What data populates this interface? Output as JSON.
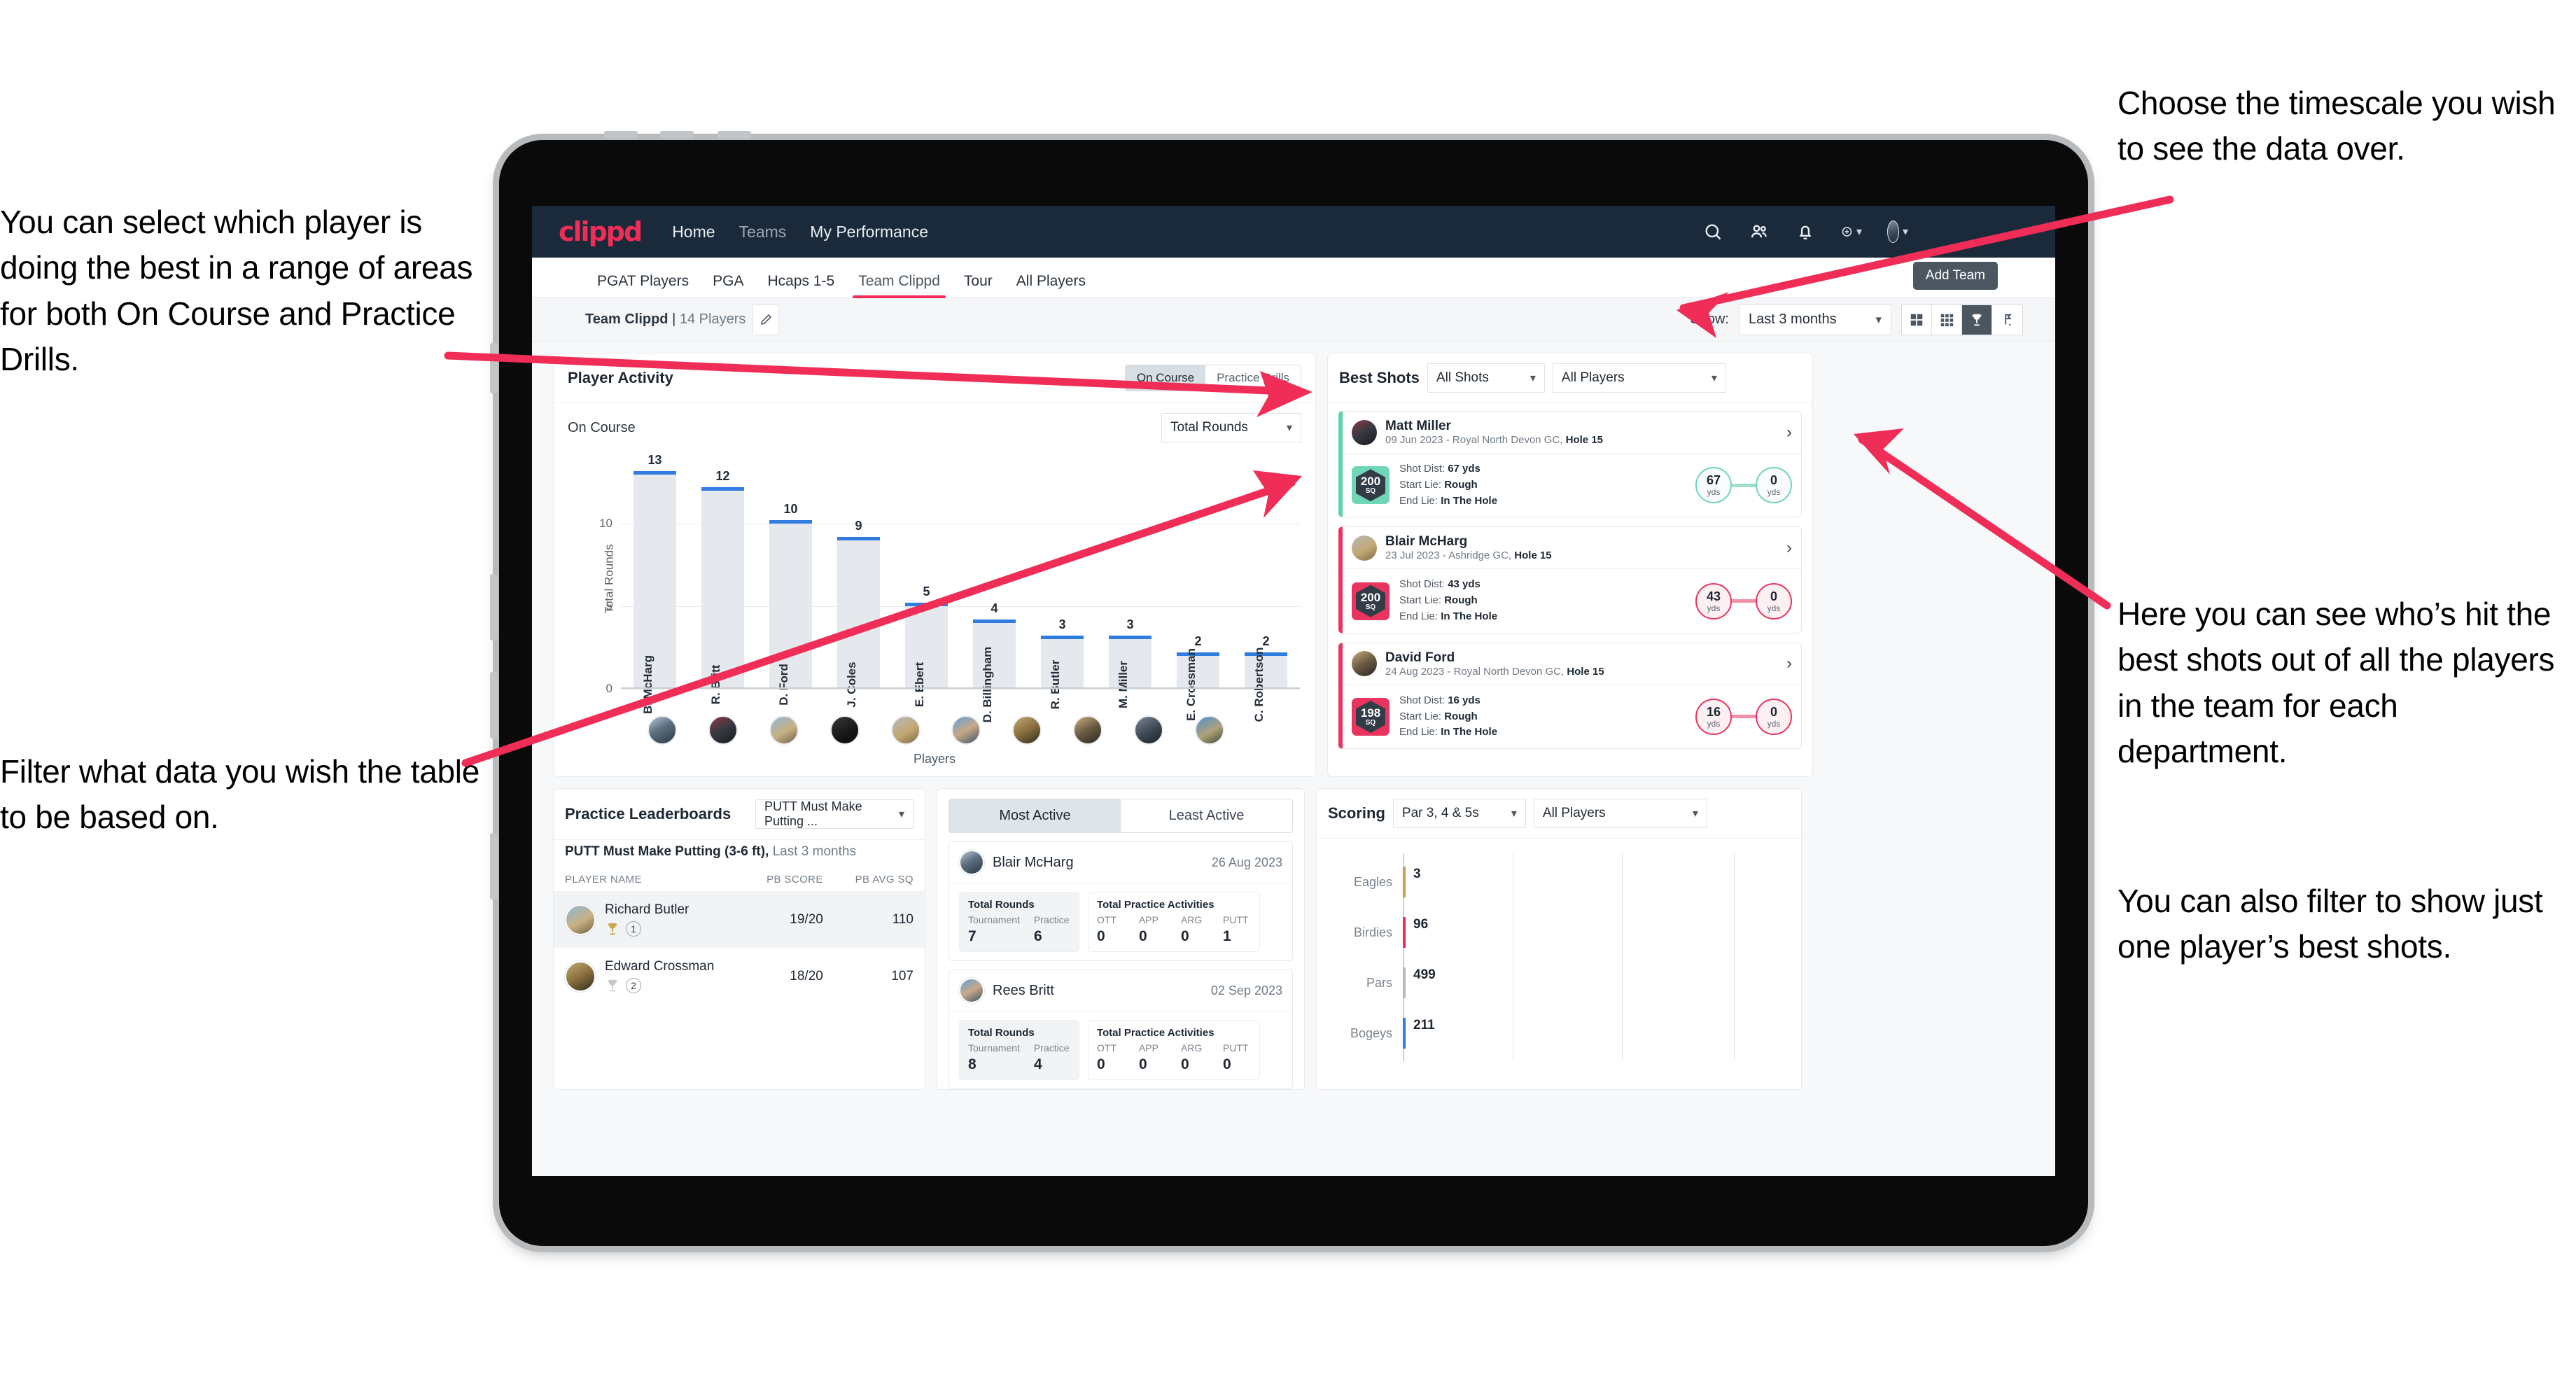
{
  "annotations": {
    "left_top": "You can select which player is doing the best in a range of areas for both On Course and Practice Drills.",
    "left_bottom": "Filter what data you wish the table to be based on.",
    "right_top": "Choose the timescale you wish to see the data over.",
    "right_mid": "Here you can see who’s hit the best shots out of all the players in the team for each department.",
    "right_bottom": "You can also filter to show just one player’s best shots."
  },
  "brand": {
    "logo": "clippd",
    "accent": "#ef2d56",
    "navbar_bg": "#1b2a3a"
  },
  "topnav": {
    "links": [
      {
        "label": "Home",
        "active": true
      },
      {
        "label": "Teams",
        "active": false
      },
      {
        "label": "My Performance",
        "active": false
      }
    ],
    "icons": [
      "search-icon",
      "people-icon",
      "bell-icon",
      "plus-circle-icon",
      "avatar"
    ]
  },
  "tabs": [
    {
      "label": "PGAT Players",
      "active": false
    },
    {
      "label": "PGA",
      "active": false
    },
    {
      "label": "Hcaps 1-5",
      "active": false
    },
    {
      "label": "Team Clippd",
      "active": true
    },
    {
      "label": "Tour",
      "active": false
    },
    {
      "label": "All Players",
      "active": false
    }
  ],
  "tooltip": {
    "add_team": "Add Team"
  },
  "subbar": {
    "team_name": "Team Clippd",
    "separator": "|",
    "player_count": "14 Players",
    "edit_icon": "pencil-icon",
    "show_label": "Show:",
    "range_value": "Last 3 months",
    "view_toggles": [
      {
        "name": "grid-2x2-icon",
        "active": false
      },
      {
        "name": "grid-3x3-icon",
        "active": false
      },
      {
        "name": "trophy-icon",
        "active": true
      },
      {
        "name": "golf-flag-icon",
        "active": false
      }
    ]
  },
  "player_activity": {
    "title": "Player Activity",
    "segments": [
      {
        "label": "On Course",
        "active": true
      },
      {
        "label": "Practice Drills",
        "active": false
      }
    ],
    "sub_label": "On Course",
    "metric_select": "Total Rounds",
    "xlabel": "Players"
  },
  "best_shots": {
    "title": "Best Shots",
    "shot_filter": "All Shots",
    "player_filter": "All Players",
    "cards": [
      {
        "name": "Matt Miller",
        "meta_date": "09 Jun 2023 - Royal North Devon GC,",
        "meta_hole": "Hole 15",
        "sq": "200",
        "sq_unit": "SQ",
        "shot_dist_label": "Shot Dist:",
        "shot_dist": "67 yds",
        "start_lie_label": "Start Lie:",
        "start_lie": "Rough",
        "end_lie_label": "End Lie:",
        "end_lie": "In The Hole",
        "from_val": "67",
        "from_unit": "yds",
        "to_val": "0",
        "to_unit": "yds",
        "accent": "teal"
      },
      {
        "name": "Blair McHarg",
        "meta_date": "23 Jul 2023 - Ashridge GC,",
        "meta_hole": "Hole 15",
        "sq": "200",
        "sq_unit": "SQ",
        "shot_dist_label": "Shot Dist:",
        "shot_dist": "43 yds",
        "start_lie_label": "Start Lie:",
        "start_lie": "Rough",
        "end_lie_label": "End Lie:",
        "end_lie": "In The Hole",
        "from_val": "43",
        "from_unit": "yds",
        "to_val": "0",
        "to_unit": "yds",
        "accent": "pink"
      },
      {
        "name": "David Ford",
        "meta_date": "24 Aug 2023 - Royal North Devon GC,",
        "meta_hole": "Hole 15",
        "sq": "198",
        "sq_unit": "SQ",
        "shot_dist_label": "Shot Dist:",
        "shot_dist": "16 yds",
        "start_lie_label": "Start Lie:",
        "start_lie": "Rough",
        "end_lie_label": "End Lie:",
        "end_lie": "In The Hole",
        "from_val": "16",
        "from_unit": "yds",
        "to_val": "0",
        "to_unit": "yds",
        "accent": "pink"
      }
    ]
  },
  "practice_leaderboards": {
    "title": "Practice Leaderboards",
    "drill_select": "PUTT Must Make Putting ...",
    "subtitle_bold": "PUTT Must Make Putting (3-6 ft),",
    "subtitle_rest": " Last 3 months",
    "columns": [
      "PLAYER NAME",
      "PB SCORE",
      "PB AVG SQ"
    ],
    "rows": [
      {
        "name": "Richard Butler",
        "rank": "1",
        "trophy": "gold",
        "pb_score": "19/20",
        "pb_avg_sq": "110"
      },
      {
        "name": "Edward Crossman",
        "rank": "2",
        "trophy": "silver",
        "pb_score": "18/20",
        "pb_avg_sq": "107"
      }
    ]
  },
  "activity": {
    "tabs": [
      {
        "label": "Most Active",
        "active": true
      },
      {
        "label": "Least Active",
        "active": false
      }
    ],
    "rounds_title": "Total Rounds",
    "practice_title": "Total Practice Activities",
    "rounds_keys": [
      "Tournament",
      "Practice"
    ],
    "practice_keys": [
      "OTT",
      "APP",
      "ARG",
      "PUTT"
    ],
    "cards": [
      {
        "name": "Blair McHarg",
        "date": "26 Aug 2023",
        "rounds": [
          "7",
          "6"
        ],
        "practice": [
          "0",
          "0",
          "0",
          "1"
        ]
      },
      {
        "name": "Rees Britt",
        "date": "02 Sep 2023",
        "rounds": [
          "8",
          "4"
        ],
        "practice": [
          "0",
          "0",
          "0",
          "0"
        ]
      }
    ]
  },
  "scoring": {
    "title": "Scoring",
    "par_filter": "Par 3, 4 & 5s",
    "player_filter": "All Players"
  },
  "chart_data": [
    {
      "type": "bar",
      "title": "Player Activity — On Course",
      "xlabel": "Players",
      "ylabel": "Total Rounds",
      "ylim": [
        0,
        14
      ],
      "yticks": [
        0,
        5,
        10
      ],
      "grid": true,
      "categories": [
        "B. McHarg",
        "R. Britt",
        "D. Ford",
        "J. Coles",
        "E. Ebert",
        "D. Billingham",
        "R. Butler",
        "M. Miller",
        "E. Crossman",
        "C. Robertson"
      ],
      "values": [
        13,
        12,
        10,
        9,
        5,
        4,
        3,
        3,
        2,
        2
      ],
      "bar_color": "#e5e8ec",
      "cap_color": "#2f7de1"
    },
    {
      "type": "bar",
      "orientation": "horizontal",
      "title": "Scoring",
      "categories": [
        "Eagles",
        "Birdies",
        "Pars",
        "Bogeys"
      ],
      "values": [
        3,
        96,
        499,
        211
      ],
      "xlim": [
        0,
        700
      ],
      "grid": true,
      "cap_colors": [
        "#c8a04e",
        "#ef2d56",
        "#b4bbc2",
        "#2f7de1"
      ]
    }
  ]
}
